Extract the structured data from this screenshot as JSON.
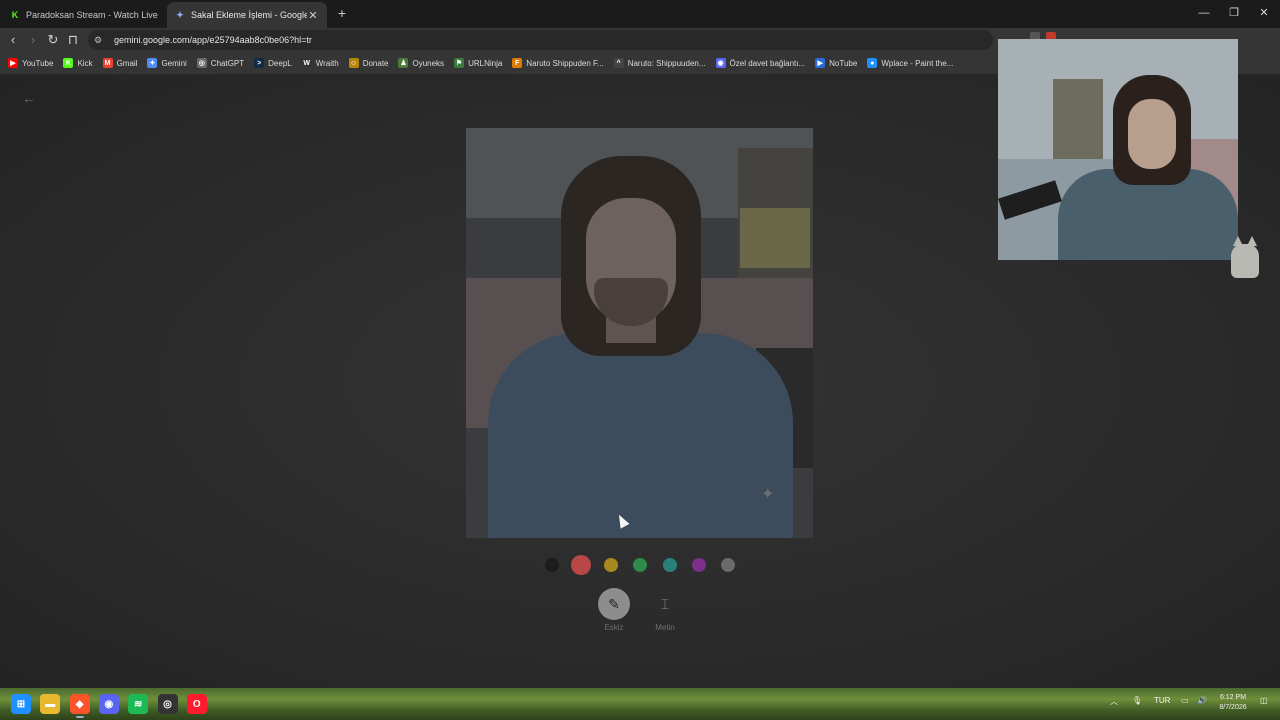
{
  "tabs": [
    {
      "title": "Paradoksan Stream - Watch Live on K",
      "favicon": "kick-icon",
      "color": "#53fc18",
      "active": false
    },
    {
      "title": "Sakal Ekleme İşlemi - Google Ge",
      "favicon": "gemini-icon",
      "color": "#8ab4f8",
      "active": true
    }
  ],
  "toolbar": {
    "url": "gemini.google.com/app/e25794aab8c0be06?hl=tr"
  },
  "bookmarks": [
    {
      "label": "YouTube",
      "icon": "youtube-icon",
      "color": "#ff0000",
      "glyph": "▶"
    },
    {
      "label": "Kick",
      "icon": "kick-icon",
      "color": "#53fc18",
      "glyph": "K"
    },
    {
      "label": "Gmail",
      "icon": "gmail-icon",
      "color": "#ea4335",
      "glyph": "M"
    },
    {
      "label": "Gemini",
      "icon": "gemini-icon",
      "color": "#4c8df6",
      "glyph": "✦"
    },
    {
      "label": "ChatGPT",
      "icon": "chatgpt-icon",
      "color": "#6b6b6b",
      "glyph": "◎"
    },
    {
      "label": "DeepL",
      "icon": "deepl-icon",
      "color": "#0f2b46",
      "glyph": ">"
    },
    {
      "label": "Wraith",
      "icon": "wraith-icon",
      "color": "#333333",
      "glyph": "W"
    },
    {
      "label": "Donate",
      "icon": "donate-icon",
      "color": "#b8860b",
      "glyph": "☺"
    },
    {
      "label": "Oyuneks",
      "icon": "oyuneks-icon",
      "color": "#4a7a3a",
      "glyph": "♟"
    },
    {
      "label": "URLNinja",
      "icon": "urlninja-icon",
      "color": "#3d7a3d",
      "glyph": "⚑"
    },
    {
      "label": "Naruto Shippuden F...",
      "icon": "naruto-icon",
      "color": "#e07b00",
      "glyph": "F"
    },
    {
      "label": "Naruto: Shippuuden...",
      "icon": "crunchyroll-icon",
      "color": "#444444",
      "glyph": "^"
    },
    {
      "label": "Özel davet bağlantı...",
      "icon": "discord-icon",
      "color": "#5865f2",
      "glyph": "◉"
    },
    {
      "label": "NoTube",
      "icon": "notube-icon",
      "color": "#2a6ad8",
      "glyph": "▶"
    },
    {
      "label": "Wplace - Paint the...",
      "icon": "wplace-icon",
      "color": "#1e90ff",
      "glyph": "●"
    }
  ],
  "page": {
    "palette": [
      {
        "name": "black",
        "color": "#1c1c1c",
        "selected": false
      },
      {
        "name": "red",
        "color": "#b84848",
        "selected": true
      },
      {
        "name": "yellow",
        "color": "#a8891f",
        "selected": false
      },
      {
        "name": "green",
        "color": "#2f8a4a",
        "selected": false
      },
      {
        "name": "teal",
        "color": "#28807d",
        "selected": false
      },
      {
        "name": "purple",
        "color": "#7d2f8c",
        "selected": false
      },
      {
        "name": "gray",
        "color": "#6b6b6b",
        "selected": false
      }
    ],
    "tools": [
      {
        "label": "Eskiz",
        "icon": "sketch-icon",
        "active": true
      },
      {
        "label": "Metin",
        "icon": "text-box-icon",
        "active": false
      }
    ]
  },
  "taskbar": {
    "apps": [
      {
        "name": "windows-start-icon",
        "color": "#1e90ff"
      },
      {
        "name": "file-explorer-icon",
        "color": "#e8b92f"
      },
      {
        "name": "brave-icon",
        "color": "#fb542b"
      },
      {
        "name": "discord-icon",
        "color": "#5865f2"
      },
      {
        "name": "spotify-icon",
        "color": "#1db954"
      },
      {
        "name": "obs-icon",
        "color": "#333333"
      },
      {
        "name": "opera-icon",
        "color": "#ff1b2d"
      }
    ],
    "language": "TUR",
    "time": "6:12 PM",
    "date": "8/7/2026"
  }
}
